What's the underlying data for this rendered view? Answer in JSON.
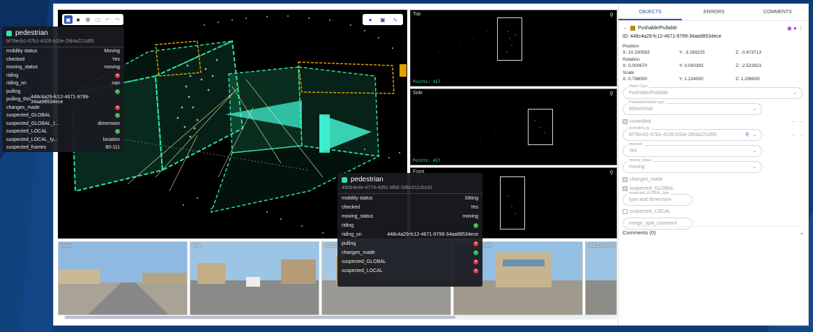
{
  "colors": {
    "accent": "#2f4fb0",
    "cuboid": "#2ee5a0",
    "ok": "#36b54a",
    "bad": "#e03a3a",
    "page_bg": "#0d3b75"
  },
  "toolbar": {
    "left_icons": [
      "cube-icon",
      "square-icon",
      "settings-icon",
      "image-icon",
      "undo-icon",
      "redo-icon"
    ],
    "right_icons": [
      "pin-icon",
      "camera-icon",
      "chart-icon"
    ]
  },
  "views": {
    "top": {
      "label": "Top",
      "points": "Points: 417"
    },
    "side": {
      "label": "Side",
      "points": "Points: 417"
    },
    "front": {
      "label": "Front"
    }
  },
  "cameras": [
    {
      "label": "main"
    },
    {
      "label": "rear"
    },
    {
      "label": "rearCornerL"
    },
    {
      "label": "Left"
    },
    {
      "label": "rearCornerR"
    }
  ],
  "panel": {
    "tabs": [
      "OBJECTS",
      "ERRORS",
      "COMMENTS"
    ],
    "object_class": "Pushable/Pullable",
    "object_id": "ID: 448c4a29-fc12-4671-9799-34aa98534ece",
    "position_label": "Position",
    "position": {
      "x": "X: 10.330563",
      "y": "Y: -3.269225",
      "z": "Z: -0.473713"
    },
    "rotation_label": "Rotation",
    "rotation": {
      "x": "X: 0.000670",
      "y": "Y: 0.000393",
      "z": "Z: -2.522823"
    },
    "scale_label": "Scale",
    "scale": {
      "x": "X: 0.798000",
      "y": "Y: 1.224000",
      "z": "Z: 1.298000"
    },
    "object_type": {
      "label": "Object Type",
      "value": "Pushable/Pullable"
    },
    "pushable_type": {
      "label": "Pushable/Pullable type",
      "value": "Wheelchair"
    },
    "controlled_label": "controlled",
    "controlled_by": {
      "label": "controlled_by",
      "value": "bf78ecb1-67b1-4105-b33e-2fd4a221d95"
    },
    "checked": {
      "label": "checked",
      "value": "Yes"
    },
    "moving_status": {
      "label": "moving_status",
      "value": "moving"
    },
    "changes_made_label": "changes_made",
    "suspected_global_label": "suspected_GLOBAL",
    "suspected_global_type": {
      "label": "suspected_GLOBAL_type",
      "value": "type and dimension"
    },
    "suspected_local_label": "suspected_LOCAL",
    "merge_split": {
      "value": "merge_split_comment"
    },
    "comments": "Comments (0)"
  },
  "tooltip1": {
    "title": "pedestrian",
    "id": "bf78ecb1-67b1-4105-b33e-2fd4a221d95",
    "rows": [
      {
        "k": "mobility status",
        "v": "Moving"
      },
      {
        "k": "checked",
        "v": "Yes"
      },
      {
        "k": "moving_status",
        "v": "moving"
      },
      {
        "k": "riding",
        "icon": "bad"
      },
      {
        "k": "riding_on",
        "v": "nan"
      },
      {
        "k": "pulling",
        "icon": "ok"
      },
      {
        "k": "pulling_this",
        "v": "448c4a29-fc12-4671-9799-34aa98534ece"
      },
      {
        "k": "changes_made",
        "icon": "bad"
      },
      {
        "k": "suspected_GLOBAL",
        "icon": "ok"
      },
      {
        "k": "suspected_GLOBAL_t...",
        "v": "dimension"
      },
      {
        "k": "suspected_LOCAL",
        "icon": "ok"
      },
      {
        "k": "suspected_LOCAL_ty...",
        "v": "location"
      },
      {
        "k": "suspected_frames",
        "v": "80-111"
      }
    ]
  },
  "tooltip2": {
    "title": "pedestrian",
    "id": "490b4e4e-4774-4d91-8fb6-5d6c011cb181",
    "rows": [
      {
        "k": "mobility status",
        "v": "Sitting"
      },
      {
        "k": "checked",
        "v": "Yes"
      },
      {
        "k": "moving_status",
        "v": "moving"
      },
      {
        "k": "riding",
        "icon": "ok"
      },
      {
        "k": "riding_on",
        "v": "448c4a29-fc12-4671-9799-34aa98534ece"
      },
      {
        "k": "pulling",
        "icon": "bad"
      },
      {
        "k": "changes_made",
        "icon": "ok"
      },
      {
        "k": "suspected_GLOBAL",
        "icon": "bad"
      },
      {
        "k": "suspected_LOCAL",
        "icon": "bad"
      }
    ]
  }
}
